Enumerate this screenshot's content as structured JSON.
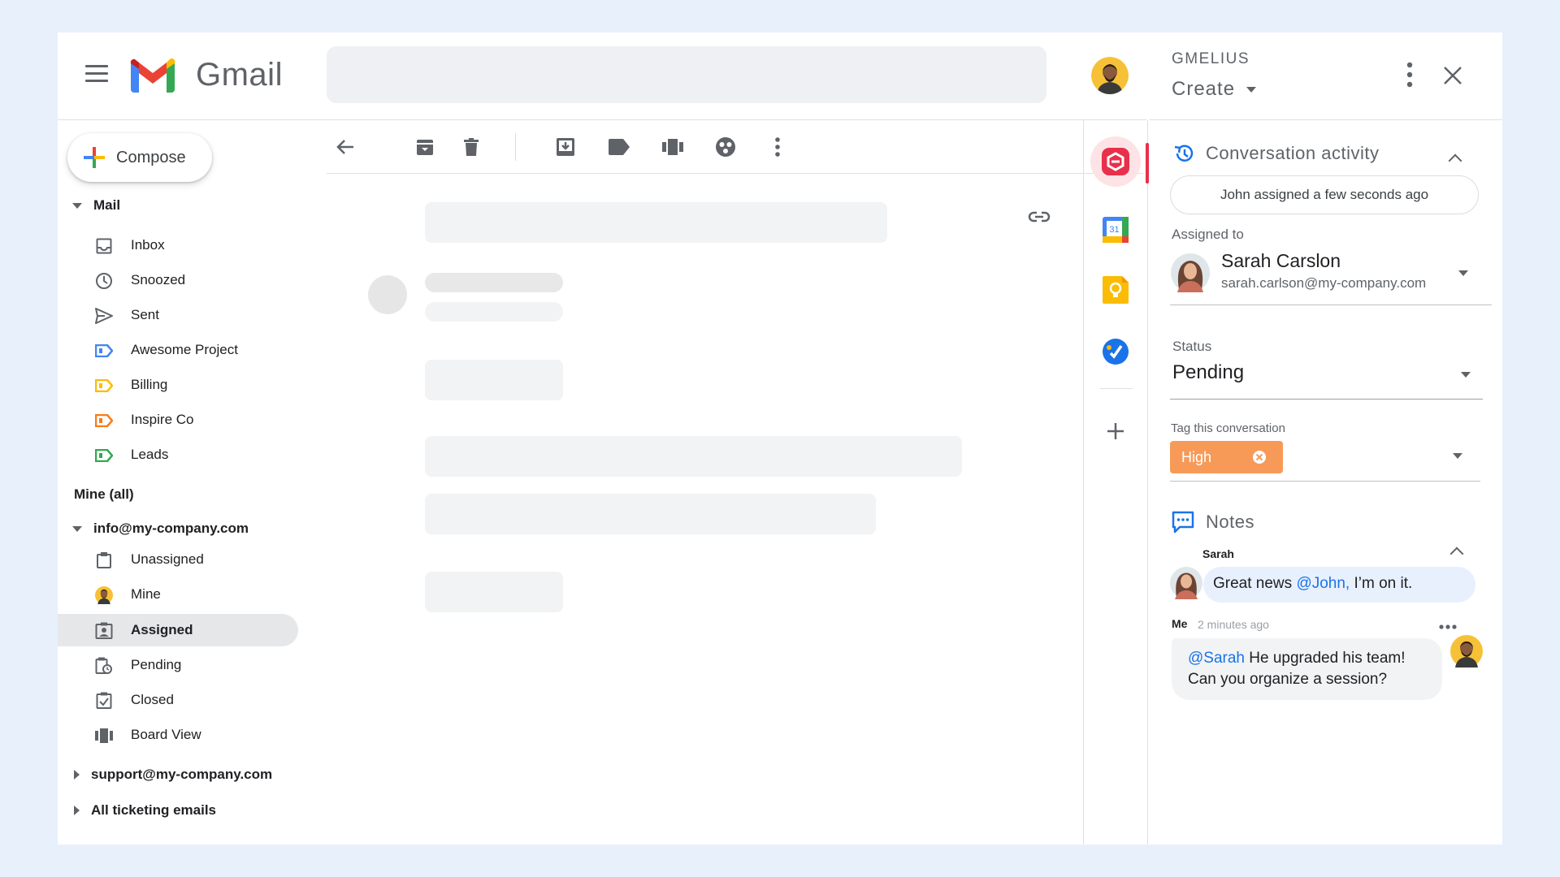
{
  "app": {
    "name": "Gmail"
  },
  "sidebar": {
    "compose_label": "Compose",
    "mail_section": "Mail",
    "mail_items": [
      {
        "label": "Inbox",
        "icon": "inbox-icon"
      },
      {
        "label": "Snoozed",
        "icon": "clock-icon"
      },
      {
        "label": "Sent",
        "icon": "send-icon"
      },
      {
        "label": "Awesome Project",
        "icon": "label-icon",
        "color": "#4285f4"
      },
      {
        "label": "Billing",
        "icon": "label-icon",
        "color": "#fbbc04"
      },
      {
        "label": "Inspire Co",
        "icon": "label-icon",
        "color": "#fa7b17"
      },
      {
        "label": "Leads",
        "icon": "label-icon",
        "color": "#34a853"
      }
    ],
    "mine_all": "Mine (all)",
    "account": "info@my-company.com",
    "account_items": [
      {
        "label": "Unassigned",
        "icon": "clipboard-icon"
      },
      {
        "label": "Mine",
        "icon": "avatar-icon"
      },
      {
        "label": "Assigned",
        "icon": "assigned-icon",
        "active": true
      },
      {
        "label": "Pending",
        "icon": "pending-icon"
      },
      {
        "label": "Closed",
        "icon": "checkbox-icon"
      },
      {
        "label": "Board View",
        "icon": "board-icon"
      }
    ],
    "other_accounts": [
      "support@my-company.com",
      "All ticketing emails"
    ]
  },
  "panel": {
    "brand": "GMELIUS",
    "create_label": "Create",
    "activity_title": "Conversation activity",
    "activity_entry": "John assigned a few seconds ago",
    "assigned_to_label": "Assigned to",
    "assignee_name": "Sarah Carslon",
    "assignee_email": "sarah.carlson@my-company.com",
    "status_label": "Status",
    "status_value": "Pending",
    "tag_label": "Tag this conversation",
    "tag_value": "High",
    "tag_color": "#f79a58",
    "notes_title": "Notes",
    "note1_author": "Sarah",
    "note1_mention": "@John,",
    "note1_text": " I’m on it.",
    "note1_prefix": "Great news ",
    "note2_author": "Me",
    "note2_time": "2 minutes ago",
    "note2_mention": "@Sarah",
    "note2_text_1": " He upgraded his team!",
    "note2_text_2": "Can you organize a session?"
  },
  "colors": {
    "accent": "#1a73e8",
    "background": "#e8f0fc",
    "gmelius_red": "#e8304b"
  }
}
